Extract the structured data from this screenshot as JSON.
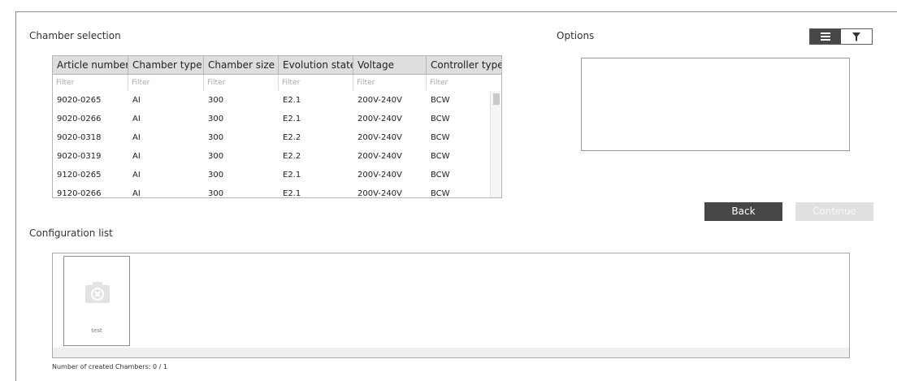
{
  "chamber_selection": {
    "title": "Chamber selection",
    "columns": [
      "Article number",
      "Chamber type",
      "Chamber size",
      "Evolution state",
      "Voltage",
      "Controller type"
    ],
    "filter_placeholder": "Filter",
    "rows": [
      [
        "9020-0265",
        "AI",
        "300",
        "E2.1",
        "200V-240V",
        "BCW"
      ],
      [
        "9020-0266",
        "AI",
        "300",
        "E2.1",
        "200V-240V",
        "BCW"
      ],
      [
        "9020-0318",
        "AI",
        "300",
        "E2.2",
        "200V-240V",
        "BCW"
      ],
      [
        "9020-0319",
        "AI",
        "300",
        "E2.2",
        "200V-240V",
        "BCW"
      ],
      [
        "9120-0265",
        "AI",
        "300",
        "E2.1",
        "200V-240V",
        "BCW"
      ],
      [
        "9120-0266",
        "AI",
        "300",
        "E2.1",
        "200V-240V",
        "BCW"
      ]
    ]
  },
  "options": {
    "title": "Options",
    "view_icons": [
      "list-icon",
      "filter-icon"
    ]
  },
  "buttons": {
    "back": "Back",
    "continue": "Continue"
  },
  "configuration": {
    "title": "Configuration list",
    "items": [
      {
        "label": "test",
        "icon": "camera-off-icon"
      }
    ],
    "count_text": "Number of created Chambers: 0 / 1"
  },
  "colors": {
    "header_bg": "#dedede",
    "button_dark": "#474747",
    "button_disabled": "#e0e0e0"
  }
}
